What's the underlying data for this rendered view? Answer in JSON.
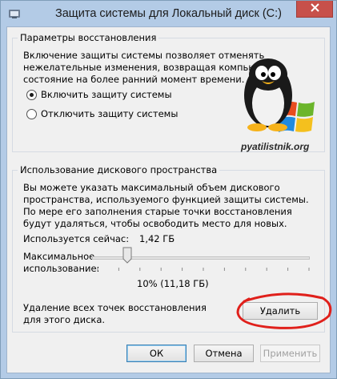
{
  "window": {
    "title": "Защита системы для Локальный диск (C:)"
  },
  "restore_settings": {
    "group_title": "Параметры восстановления",
    "description": "Включение защиты системы позволяет отменять нежелательные изменения, возвращая компьютер в состояние на более ранний момент времени.",
    "options": [
      {
        "label": "Включить защиту системы",
        "selected": true
      },
      {
        "label": "Отключить защиту системы",
        "selected": false
      }
    ]
  },
  "watermark": {
    "text": "pyatilistnik.org"
  },
  "disk_usage": {
    "group_title": "Использование дискового пространства",
    "description": "Вы можете указать максимальный объем дискового пространства, используемого функцией защиты системы. По мере его заполнения старые точки восстановления будут удаляться, чтобы освободить место для новых.",
    "current_label": "Используется сейчас:",
    "current_value": "1,42 ГБ",
    "max_label": "Максимальное использование:",
    "max_value": "10% (11,18 ГБ)",
    "slider_fraction": 0.1,
    "delete_text": "Удаление всех точек восстановления для этого диска.",
    "delete_button": "Удалить"
  },
  "footer": {
    "ok": "ОК",
    "cancel": "Отмена",
    "apply": "Применить"
  },
  "colors": {
    "frame": "#b3cbe6",
    "close": "#c7504a",
    "annotation": "#e0201b"
  },
  "icons": {
    "app": "shield-icon",
    "close": "close-icon"
  }
}
